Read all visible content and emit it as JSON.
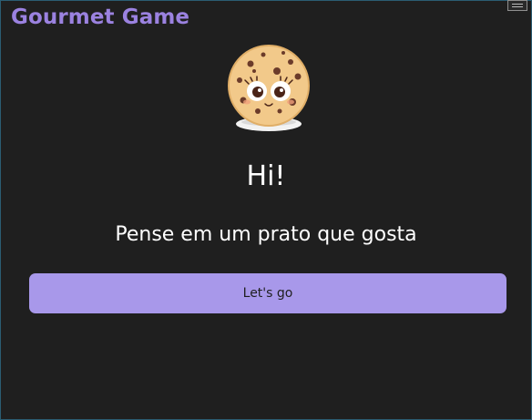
{
  "app": {
    "title": "Gourmet Game"
  },
  "icons": {
    "menu": "hamburger-menu-icon",
    "mascot": "cookie-mascot-icon"
  },
  "main": {
    "greeting": "Hi!",
    "prompt": "Pense em um prato que gosta",
    "start_button_label": "Let's go"
  },
  "colors": {
    "background": "#1f1f1f",
    "title": "#9b82e0",
    "button": "#a898ea",
    "text": "#ffffff"
  }
}
